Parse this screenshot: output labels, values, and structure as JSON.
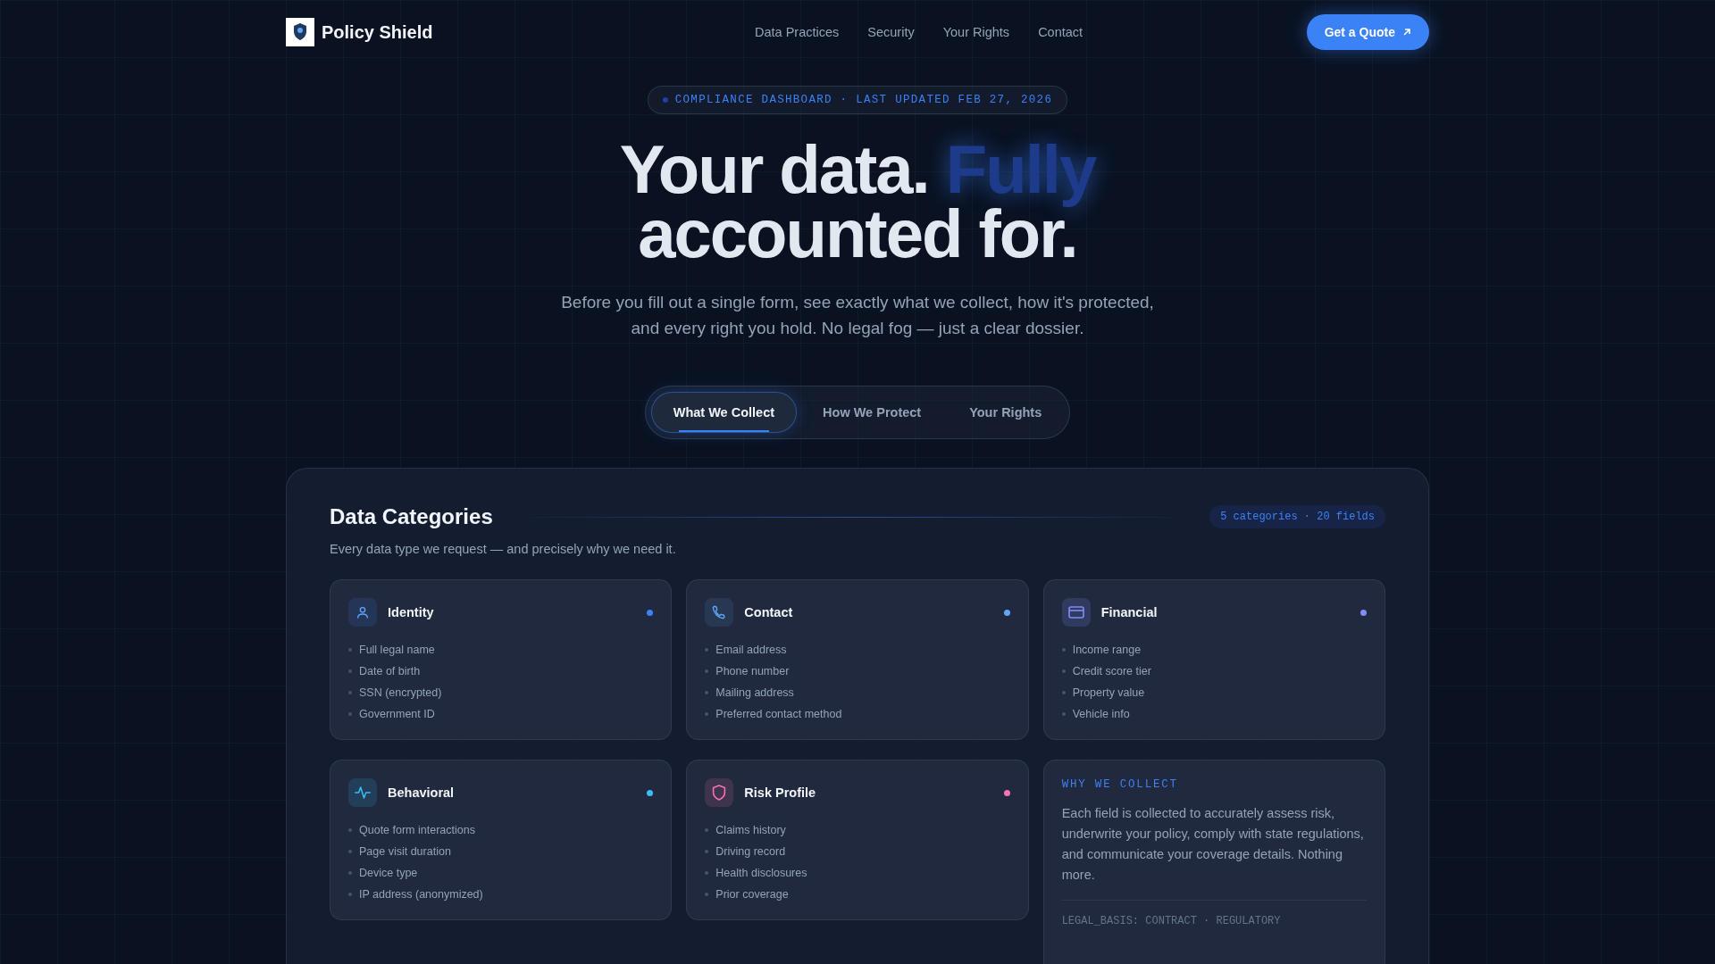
{
  "nav": {
    "brand": "Policy Shield",
    "links": [
      "Data Practices",
      "Security",
      "Your Rights",
      "Contact"
    ],
    "cta": "Get a Quote"
  },
  "hero": {
    "badge": "COMPLIANCE DASHBOARD · LAST UPDATED FEB 27, 2026",
    "title_start": "Your data.",
    "title_highlight": "Fully",
    "title_end": "accounted for.",
    "subtitle": "Before you fill out a single form, see exactly what we collect, how it's protected, and every right you hold. No legal fog — just a clear dossier."
  },
  "tabs": [
    {
      "label": "What We Collect",
      "selected": true
    },
    {
      "label": "How We Protect",
      "selected": false
    },
    {
      "label": "Your Rights",
      "selected": false
    }
  ],
  "panel": {
    "title": "Data Categories",
    "count": "5 categories · 20 fields",
    "subtitle": "Every data type we request — and precisely why we need it.",
    "cards": [
      {
        "kind": "category",
        "title": "Identity",
        "color": "#3b82f6",
        "items": [
          "Full legal name",
          "Date of birth",
          "SSN (encrypted)",
          "Government ID"
        ]
      },
      {
        "kind": "category",
        "title": "Contact",
        "color": "#60a5fa",
        "items": [
          "Email address",
          "Phone number",
          "Mailing address",
          "Preferred contact method"
        ]
      },
      {
        "kind": "category",
        "title": "Financial",
        "color": "#818cf8",
        "items": [
          "Income range",
          "Credit score tier",
          "Property value",
          "Vehicle info"
        ]
      },
      {
        "kind": "category",
        "title": "Behavioral",
        "color": "#38bdf8",
        "items": [
          "Quote form interactions",
          "Page visit duration",
          "Device type",
          "IP address (anonymized)"
        ]
      },
      {
        "kind": "category",
        "title": "Risk Profile",
        "color": "#f472b6",
        "items": [
          "Claims history",
          "Driving record",
          "Health disclosures",
          "Prior coverage"
        ]
      },
      {
        "kind": "note",
        "heading": "WHY WE COLLECT",
        "text": "Each field is collected to accurately assess risk, underwrite your policy, comply with state regulations, and communicate your coverage details. Nothing more.",
        "footer": "LEGAL_BASIS: CONTRACT · REGULATORY"
      }
    ]
  }
}
